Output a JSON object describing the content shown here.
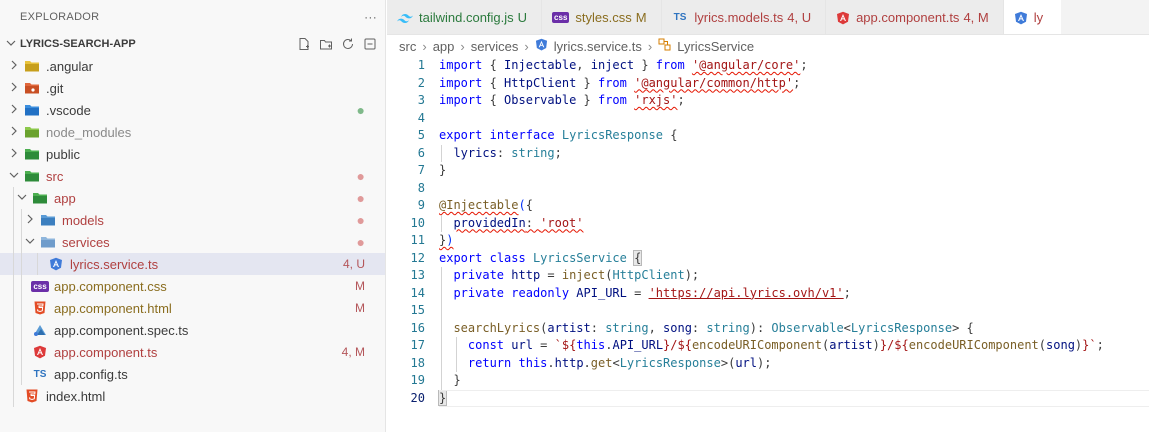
{
  "sidebar": {
    "header_title": "EXPLORADOR",
    "header_more": "···",
    "section_title": "LYRICS-SEARCH-APP",
    "items": [
      {
        "label": ".angular",
        "decoration": "",
        "icon": "folder-angular-icon"
      },
      {
        "label": ".git",
        "decoration": "",
        "icon": "folder-git-icon"
      },
      {
        "label": ".vscode",
        "decoration": "●",
        "icon": "folder-vscode-icon"
      },
      {
        "label": "node_modules",
        "decoration": "",
        "icon": "folder-node-icon"
      },
      {
        "label": "public",
        "decoration": "",
        "icon": "folder-public-icon"
      },
      {
        "label": "src",
        "decoration": "●",
        "icon": "folder-src-icon"
      },
      {
        "label": "app",
        "decoration": "●",
        "icon": "folder-app-icon"
      },
      {
        "label": "models",
        "decoration": "●",
        "icon": "folder-models-icon"
      },
      {
        "label": "services",
        "decoration": "●",
        "icon": "folder-services-icon"
      },
      {
        "label": "lyrics.service.ts",
        "decoration": "4, U",
        "icon": "angular-icon"
      },
      {
        "label": "app.component.css",
        "decoration": "M",
        "icon": "css-icon"
      },
      {
        "label": "app.component.html",
        "decoration": "M",
        "icon": "html-icon"
      },
      {
        "label": "app.component.spec.ts",
        "decoration": "",
        "icon": "spec-icon"
      },
      {
        "label": "app.component.ts",
        "decoration": "4, M",
        "icon": "angular-icon"
      },
      {
        "label": "app.config.ts",
        "decoration": "",
        "icon": "typescript-icon"
      },
      {
        "label": "index.html",
        "decoration": "",
        "icon": "html-icon"
      }
    ]
  },
  "tabs": [
    {
      "name": "tailwind.config.js",
      "badge": "U"
    },
    {
      "name": "styles.css",
      "badge": "M"
    },
    {
      "name": "lyrics.models.ts",
      "badge": "4, U"
    },
    {
      "name": "app.component.ts",
      "badge": "4, M"
    },
    {
      "name": "ly",
      "badge": ""
    }
  ],
  "breadcrumb": [
    "src",
    "app",
    "services",
    "lyrics.service.ts",
    "LyricsService"
  ],
  "code": {
    "line_numbers": [
      "1",
      "2",
      "3",
      "4",
      "5",
      "6",
      "7",
      "8",
      "9",
      "10",
      "11",
      "12",
      "13",
      "14",
      "15",
      "16",
      "17",
      "18",
      "19",
      "20"
    ],
    "strings": {
      "angular_core": "'@angular/core'",
      "angular_http": "'@angular/common/http'",
      "rxjs": "'rxjs'",
      "root": "'root'",
      "api_url": "'https://api.lyrics.ovh/v1'"
    }
  },
  "colors": {
    "selected_row": "#e4e6f1",
    "keyword": "#0000ff",
    "string": "#a31515",
    "type": "#267f99"
  }
}
